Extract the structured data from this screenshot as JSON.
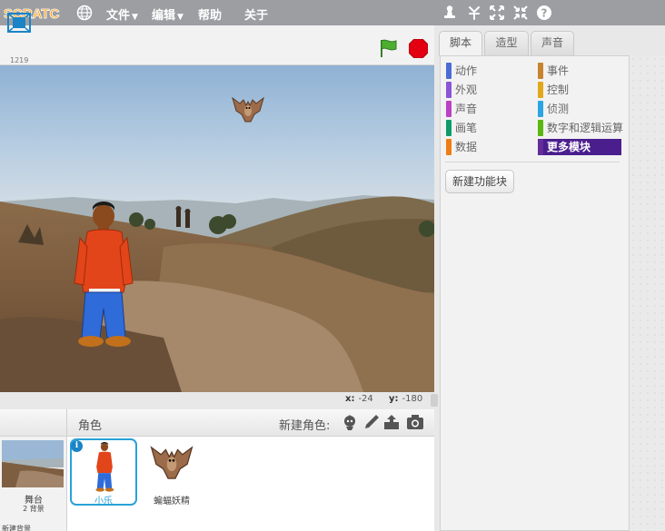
{
  "app": {
    "logo_text": "SCRATCH",
    "version": "1219"
  },
  "menu": {
    "items": [
      {
        "label": "文件",
        "has_caret": true
      },
      {
        "label": "编辑",
        "has_caret": true
      },
      {
        "label": "帮助",
        "has_caret": false
      },
      {
        "label": "关于",
        "has_caret": false
      }
    ],
    "caret": "▼"
  },
  "toolbar": {
    "icons": [
      "duplicate-icon",
      "delete-icon",
      "grow-icon",
      "shrink-icon",
      "help-icon"
    ]
  },
  "stage": {
    "coords": {
      "x_label": "x:",
      "x_value": "-24",
      "y_label": "y:",
      "y_value": "-180"
    }
  },
  "sprites_panel": {
    "title": "角色",
    "new_sprite_label": "新建角色:",
    "stage_name": "舞台",
    "stage_count": "2 背景",
    "stage_new_backdrop": "新建背景",
    "sprites": [
      {
        "name": "小乐",
        "selected": true
      },
      {
        "name": "蝙蝠妖精",
        "selected": false
      }
    ],
    "info_badge": "i"
  },
  "tabs": [
    {
      "label": "脚本",
      "active": true
    },
    {
      "label": "造型",
      "active": false
    },
    {
      "label": "声音",
      "active": false
    }
  ],
  "categories": [
    {
      "label": "动作",
      "color": "#4a6cd4"
    },
    {
      "label": "事件",
      "color": "#c88330"
    },
    {
      "label": "外观",
      "color": "#8a55d7"
    },
    {
      "label": "控制",
      "color": "#e1a91a"
    },
    {
      "label": "声音",
      "color": "#bb42c3"
    },
    {
      "label": "侦测",
      "color": "#2ca5e2"
    },
    {
      "label": "画笔",
      "color": "#0e9a6c"
    },
    {
      "label": "数字和逻辑运算",
      "color": "#5cb712"
    },
    {
      "label": "数据",
      "color": "#ee7d16"
    },
    {
      "label": "更多模块",
      "color": "#632d99"
    }
  ],
  "new_block_button": "新建功能块"
}
